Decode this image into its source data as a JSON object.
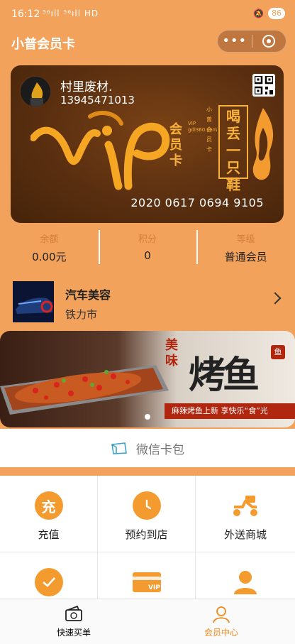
{
  "status_bar": {
    "time": "16:12",
    "signal": "⁵⁶ıll ⁵⁶ıll HD",
    "battery": "86"
  },
  "app": {
    "title": "小普会员卡"
  },
  "card": {
    "name": "村里废材.",
    "phone": "13945471013",
    "card_label": "会员卡",
    "small_vertical": "VIP gdl360.com",
    "brand_small": "小普会员卡",
    "brand_name": "喝丢一只鞋",
    "number": "2020 0617 0694 9105"
  },
  "stats": [
    {
      "label": "余额",
      "value": "0.00元"
    },
    {
      "label": "积分",
      "value": "0"
    },
    {
      "label": "等级",
      "value": "普通会员"
    }
  ],
  "store": {
    "name": "汽车美容",
    "location": "铁力市"
  },
  "banner": {
    "mei": "美味",
    "headline": "烤鱼",
    "seal": "鱼",
    "ribbon": "麻辣烤鱼上新  享快乐“食”光"
  },
  "wechat_card_pack": {
    "label": "微信卡包"
  },
  "grid": [
    {
      "label": "充值",
      "icon": "charge-icon",
      "glyph": "充"
    },
    {
      "label": "预约到店",
      "icon": "clock-icon",
      "glyph": ""
    },
    {
      "label": "外送商城",
      "icon": "delivery-scooter-icon",
      "glyph": ""
    },
    {
      "label": "",
      "icon": "check-ticket-icon",
      "glyph": ""
    },
    {
      "label": "",
      "icon": "vip-card-icon",
      "glyph": ""
    },
    {
      "label": "",
      "icon": "user-icon",
      "glyph": ""
    }
  ],
  "tabs": [
    {
      "label": "快速买单",
      "icon": "wallet-icon"
    },
    {
      "label": "会员中心",
      "icon": "member-icon"
    }
  ],
  "colors": {
    "primary": "#f2a25b",
    "accent": "#f08a1c",
    "card_dark": "#5a2f10",
    "gold": "#f7b13a"
  }
}
